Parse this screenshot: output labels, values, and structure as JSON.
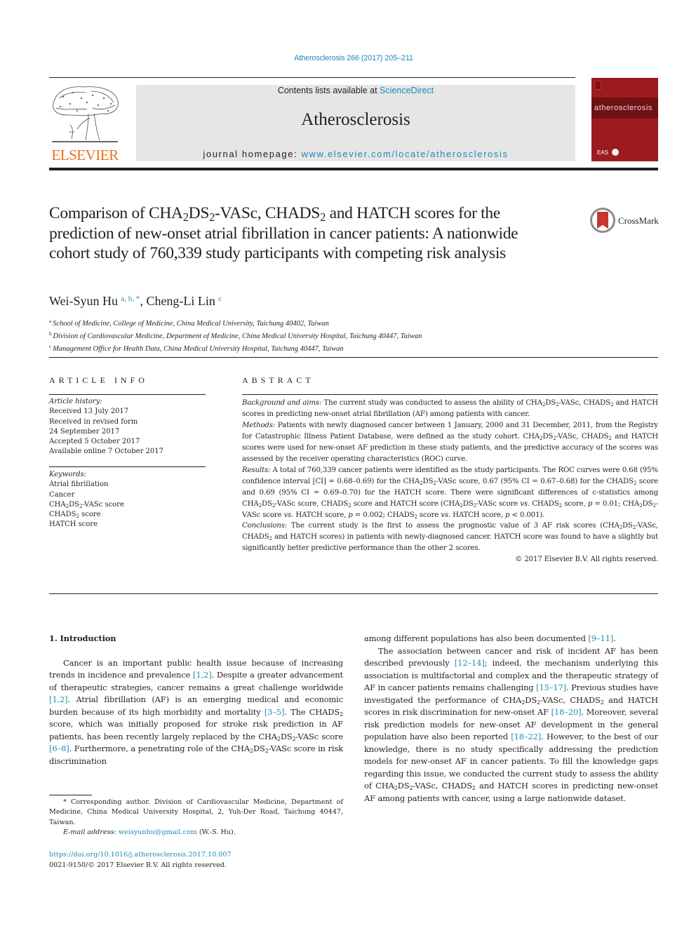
{
  "header": {
    "citation": "Atherosclerosis 266 (2017) 205–211",
    "contents_prefix": "Contents lists available at ",
    "contents_link": "ScienceDirect",
    "journal_title": "Atherosclerosis",
    "homepage_prefix": "journal homepage: ",
    "homepage_link": "www.elsevier.com/locate/atherosclerosis",
    "publisher_wordmark": "ELSEVIER",
    "cover_title": "atherosclerosis",
    "cover_society": "EAS",
    "publisher_color": "#e9711c",
    "cover_color": "#9b1b1f",
    "link_color": "#1f8ab5"
  },
  "article": {
    "title_parts": {
      "p1": "Comparison of CHA",
      "s1": "2",
      "p2": "DS",
      "s2": "2",
      "p3": "-VASc, CHADS",
      "s3": "2",
      "p4": " and HATCH scores for the prediction of new-onset atrial fibrillation in cancer patients: A nationwide cohort study of 760,339 study participants with competing risk analysis"
    },
    "crossmark_label": "CrossMark",
    "authors": [
      {
        "name": "Wei-Syun Hu",
        "sup": "a, b, *"
      },
      {
        "name": "Cheng-Li Lin",
        "sup": "c"
      }
    ],
    "author_separator": ", ",
    "affiliations": [
      {
        "key": "a",
        "text": "School of Medicine, College of Medicine, China Medical University, Taichung 40402, Taiwan"
      },
      {
        "key": "b",
        "text": "Division of Cardiovascular Medicine, Department of Medicine, China Medical University Hospital, Taichung 40447, Taiwan"
      },
      {
        "key": "c",
        "text": "Management Office for Health Data, China Medical University Hospital, Taichung 40447, Taiwan"
      }
    ]
  },
  "article_info": {
    "heading": "ARTICLE INFO",
    "history_label": "Article history:",
    "history": [
      "Received 13 July 2017",
      "Received in revised form",
      "24 September 2017",
      "Accepted 5 October 2017",
      "Available online 7 October 2017"
    ],
    "keywords_label": "Keywords:",
    "keywords": [
      "Atrial fibrillation",
      "Cancer",
      "CHA2DS2-VASc score",
      "CHADS2 score",
      "HATCH score"
    ]
  },
  "abstract": {
    "heading": "ABSTRACT",
    "background_label": "Background and aims:",
    "methods_label": "Methods:",
    "results_label": "Results:",
    "conclusions_label": "Conclusions:",
    "copyright": "© 2017 Elsevier B.V. All rights reserved."
  },
  "introduction": {
    "heading": "1.  Introduction"
  },
  "footnote": {
    "corresponding": "* Corresponding author. Division of Cardiovascular Medicine, Department of Medicine, China Medical University Hospital, 2, Yuh-Der Road, Taichung 40447, Taiwan.",
    "email_label": "E-mail address:",
    "email": "weisyunhu@gmail.com",
    "email_suffix": " (W.-S. Hu).",
    "doi": "https://doi.org/10.1016/j.atherosclerosis.2017.10.007",
    "issn": "0021-9150/© 2017 Elsevier B.V. All rights reserved."
  },
  "refs": {
    "r1": "[1,2]",
    "r2": "[1,2]",
    "r3": "[3–5]",
    "r4": "[6–8]",
    "r5": "[9–11]",
    "r6": "[12–14]",
    "r7": "[15–17]",
    "r8": "[18–20]",
    "r9": "[18–22]"
  },
  "text": {
    "bg": " The current study was conducted to assess the ability of CHA₂DS₂-VASc, CHADS₂ and HATCH scores in predicting new-onset atrial fibrillation (AF) among patients with cancer.",
    "methods": " Patients with newly diagnosed cancer between 1 January, 2000 and 31 December, 2011, from the Registry for Catastrophic Illness Patient Database, were defined as the study cohort. CHA₂DS₂-VASc, CHADS₂ and HATCH scores were used for new-onset AF prediction in these study patients, and the predictive accuracy of the scores was assessed by the receiver operating characteristics (ROC) curve.",
    "results": " A total of 760,339 cancer patients were identified as the study participants. The ROC curves were 0.68 (95% confidence interval [CI] = 0.68–0.69) for the CHA₂DS₂-VASc score, 0.67 (95% CI = 0.67–0.68) for the CHADS₂ score and 0.69 (95% CI = 0.69–0.70) for the HATCH score. There were significant differences of c-statistics among CHA₂DS₂-VASc score, CHADS₂ score and HATCH score (CHA₂DS₂-VASc score vs. CHADS₂ score, p = 0.01; CHA₂DS₂-VASc score vs. HATCH score, p = 0.002; CHADS₂ score vs. HATCH score, p < 0.001).",
    "conclusions": " The current study is the first to assess the prognostic value of 3 AF risk scores (CHA₂DS₂-VASc, CHADS₂ and HATCH scores) in patients with newly-diagnosed cancer. HATCH score was found to have a slightly but significantly better predictive performance than the other 2 scores.",
    "l1": "Cancer is an important public health issue because of increasing trends in incidence and prevalence ",
    "l2": ". Despite a greater advancement of therapeutic strategies, cancer remains a great challenge worldwide ",
    "l3": ". Atrial fibrillation (AF) is an emerging medical and economic burden because of its high morbidity and mortality ",
    "l4": ". The CHADS₂ score, which was initially proposed for stroke risk prediction in AF patients, has been recently largely replaced by the CHA₂DS₂-VASc score ",
    "l5": ". Furthermore, a penetrating role of the CHA₂DS₂-VASc score in risk discrimination",
    "r1a": "among different populations has also been documented ",
    "r1b": ".",
    "r2a": "The association between cancer and risk of incident AF has been described previously ",
    "r2b": "; indeed, the mechanism underlying this association is multifactorial and complex and the therapeutic strategy of AF in cancer patients remains challenging ",
    "r2c": ". Previous studies have investigated the performance of CHA₂DS₂-VASc, CHADS₂ and HATCH scores in risk discrimination for new-onset AF ",
    "r2d": ". Moreover, several risk prediction models for new-onset AF development in the general population have also been reported ",
    "r2e": ". However, to the best of our knowledge, there is no study specifically addressing the prediction models for new-onset AF in cancer patients. To fill the knowledge gaps regarding this issue, we conducted the current study to assess the ability of CHA₂DS₂-VASc, CHADS₂ and HATCH scores in predicting new-onset AF among patients with cancer, using a large nationwide dataset."
  }
}
